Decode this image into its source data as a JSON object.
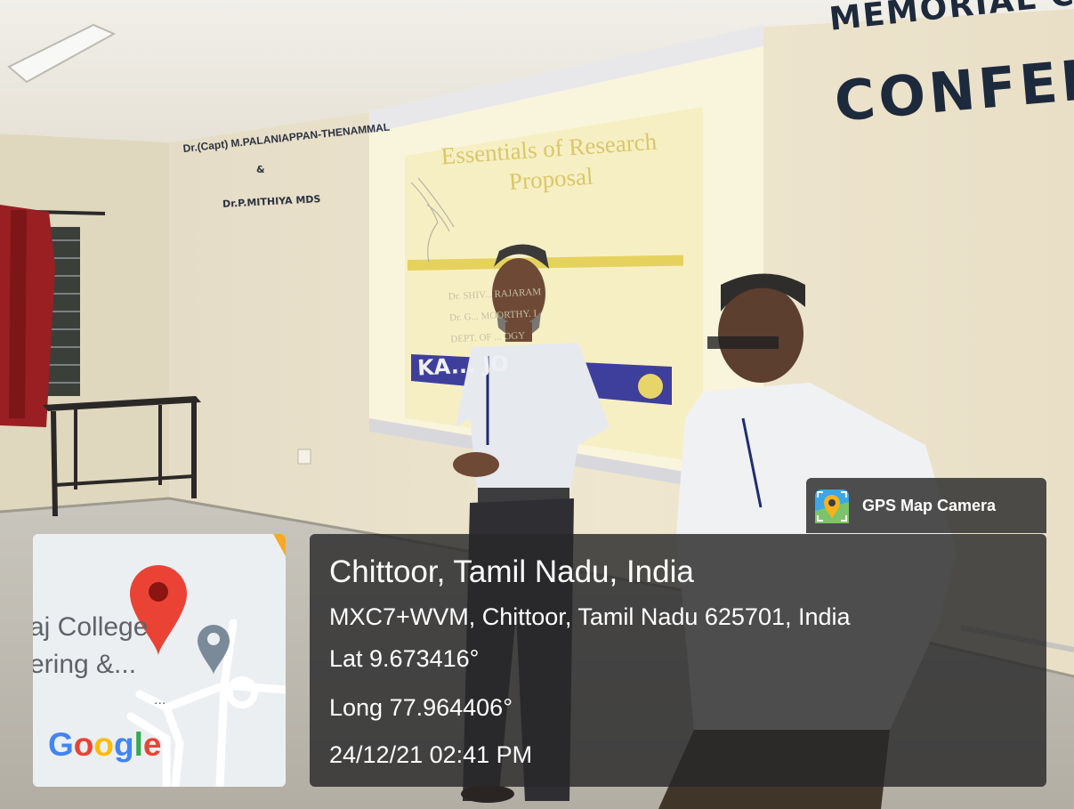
{
  "wall": {
    "memorial_text": "MEMORIAL C",
    "conference_text": "CONFEI",
    "plaque_line1": "Dr.(Capt) M.PALANIAPPAN-THENAMMAL",
    "plaque_line2": "&",
    "plaque_line3": "Dr.P.MITHIYA MDS"
  },
  "slide": {
    "title": "Essentials of Research Proposal",
    "author_line1": "Dr. SHIV... RAJARAM",
    "author_line2": "Dr. G... MOORTHY. I",
    "author_line3": "DEPT. OF ... OGY",
    "logo_text": "KA... JO"
  },
  "map": {
    "label_line1": "aj College",
    "label_line2": "ering &...",
    "dots": "...",
    "logo": [
      "G",
      "o",
      "o",
      "g",
      "l",
      "e"
    ],
    "logo_colors": [
      "#4285F4",
      "#EA4335",
      "#FBBC05",
      "#4285F4",
      "#34A853",
      "#EA4335"
    ],
    "pin_color": "#EA4335",
    "secondary_pin_color": "#7a8a99"
  },
  "badge": {
    "label": "GPS Map Camera",
    "icon": "gps-map-camera-icon"
  },
  "location": {
    "title": "Chittoor, Tamil Nadu, India",
    "address": "MXC7+WVM, Chittoor, Tamil Nadu 625701, India",
    "lat": "Lat 9.673416°",
    "long": "Long 77.964406°",
    "datetime": "24/12/21 02:41 PM"
  },
  "colors": {
    "card_bg": "#28282a",
    "wall": "#ece3cc",
    "projected_slide": "#f6efc8"
  }
}
